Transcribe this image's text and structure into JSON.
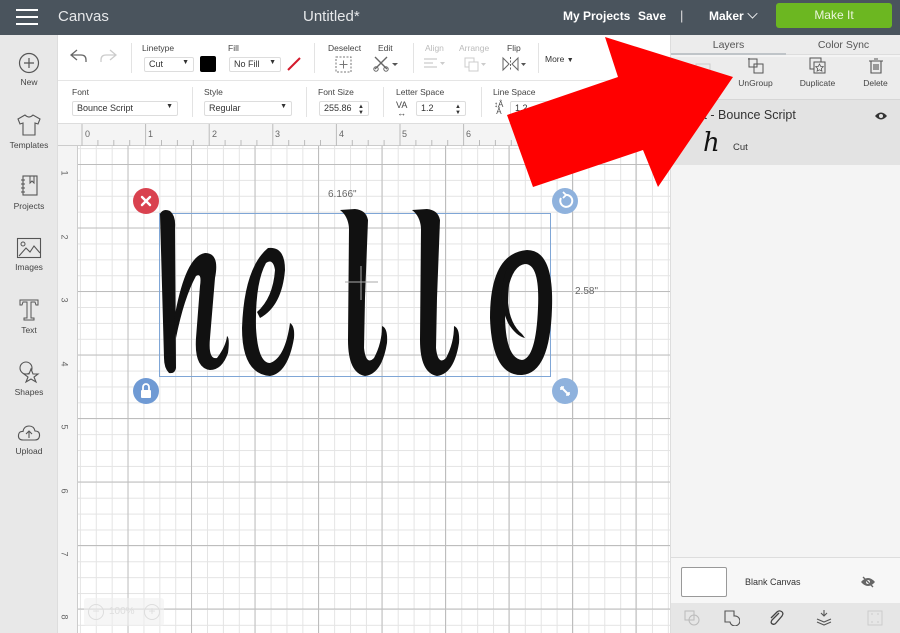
{
  "topbar": {
    "app_name": "Canvas",
    "document_title": "Untitled*",
    "my_projects": "My Projects",
    "save": "Save",
    "separator": "|",
    "machine": "Maker",
    "make_it": "Make It",
    "make_it_color": "#6cb721"
  },
  "sidebar": {
    "items": [
      {
        "label": "New",
        "icon": "plus-circle-icon"
      },
      {
        "label": "Templates",
        "icon": "tshirt-icon"
      },
      {
        "label": "Projects",
        "icon": "notebook-icon"
      },
      {
        "label": "Images",
        "icon": "image-icon"
      },
      {
        "label": "Text",
        "icon": "text-icon"
      },
      {
        "label": "Shapes",
        "icon": "shapes-icon"
      },
      {
        "label": "Upload",
        "icon": "upload-cloud-icon"
      }
    ]
  },
  "toolbar": {
    "linetype_label": "Linetype",
    "linetype_value": "Cut",
    "linetype_color": "#000000",
    "fill_label": "Fill",
    "fill_value": "No Fill",
    "deselect_label": "Deselect",
    "edit_label": "Edit",
    "align_label": "Align",
    "arrange_label": "Arrange",
    "flip_label": "Flip",
    "more_label": "More",
    "font_label": "Font",
    "font_value": "Bounce Script",
    "style_label": "Style",
    "style_value": "Regular",
    "font_size_label": "Font Size",
    "font_size_value": "255.86",
    "letter_space_label": "Letter Space",
    "letter_space_value": "1.2",
    "line_space_label": "Line Space",
    "line_space_value": "1.2"
  },
  "ruler": {
    "horizontal": [
      "0",
      "1",
      "2",
      "3",
      "4",
      "5",
      "6"
    ],
    "vertical": [
      "1",
      "2",
      "3",
      "4",
      "5",
      "6",
      "7",
      "8"
    ]
  },
  "canvas": {
    "text": "hello",
    "width_label": "6.166\"",
    "height_label": "2.58\"",
    "zoom": "100%"
  },
  "panel": {
    "tabs": [
      "Layers",
      "Color Sync"
    ],
    "actions": [
      "UnGroup",
      "Duplicate",
      "Delete"
    ],
    "layer_title": "Text - Bounce Script",
    "layer_sub_label": "Cut",
    "layer_thumb_glyph": "h",
    "blank_canvas": "Blank Canvas"
  },
  "annotation": {
    "arrow_color": "#ff0000"
  }
}
